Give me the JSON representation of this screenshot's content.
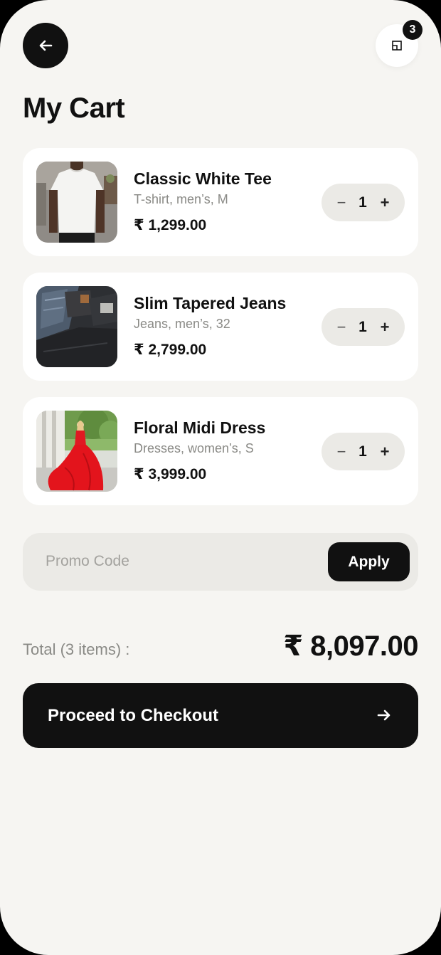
{
  "header": {
    "title": "My Cart",
    "cart_count": "3"
  },
  "items": [
    {
      "name": "Classic White Tee",
      "desc": "T-shirt, men’s, M",
      "price": "₹ 1,299.00",
      "qty": "1",
      "image_icon": "white-tshirt-photo"
    },
    {
      "name": "Slim Tapered Jeans",
      "desc": "Jeans, men’s, 32",
      "price": "₹ 2,799.00",
      "qty": "1",
      "image_icon": "folded-jeans-photo"
    },
    {
      "name": "Floral Midi Dress",
      "desc": "Dresses, women’s, S",
      "price": "₹ 3,999.00",
      "qty": "1",
      "image_icon": "red-dress-photo"
    }
  ],
  "qty_controls": {
    "minus": "−",
    "plus": "+"
  },
  "promo": {
    "placeholder": "Promo Code",
    "value": "",
    "apply_label": "Apply"
  },
  "summary": {
    "total_label": "Total (3 items) :",
    "total_value": "₹ 8,097.00"
  },
  "checkout": {
    "label": "Proceed to Checkout"
  },
  "colors": {
    "background": "#f6f5f2",
    "card": "#ffffff",
    "primary": "#111111",
    "muted_text": "#8a8a86",
    "pill": "#ebeae6"
  }
}
